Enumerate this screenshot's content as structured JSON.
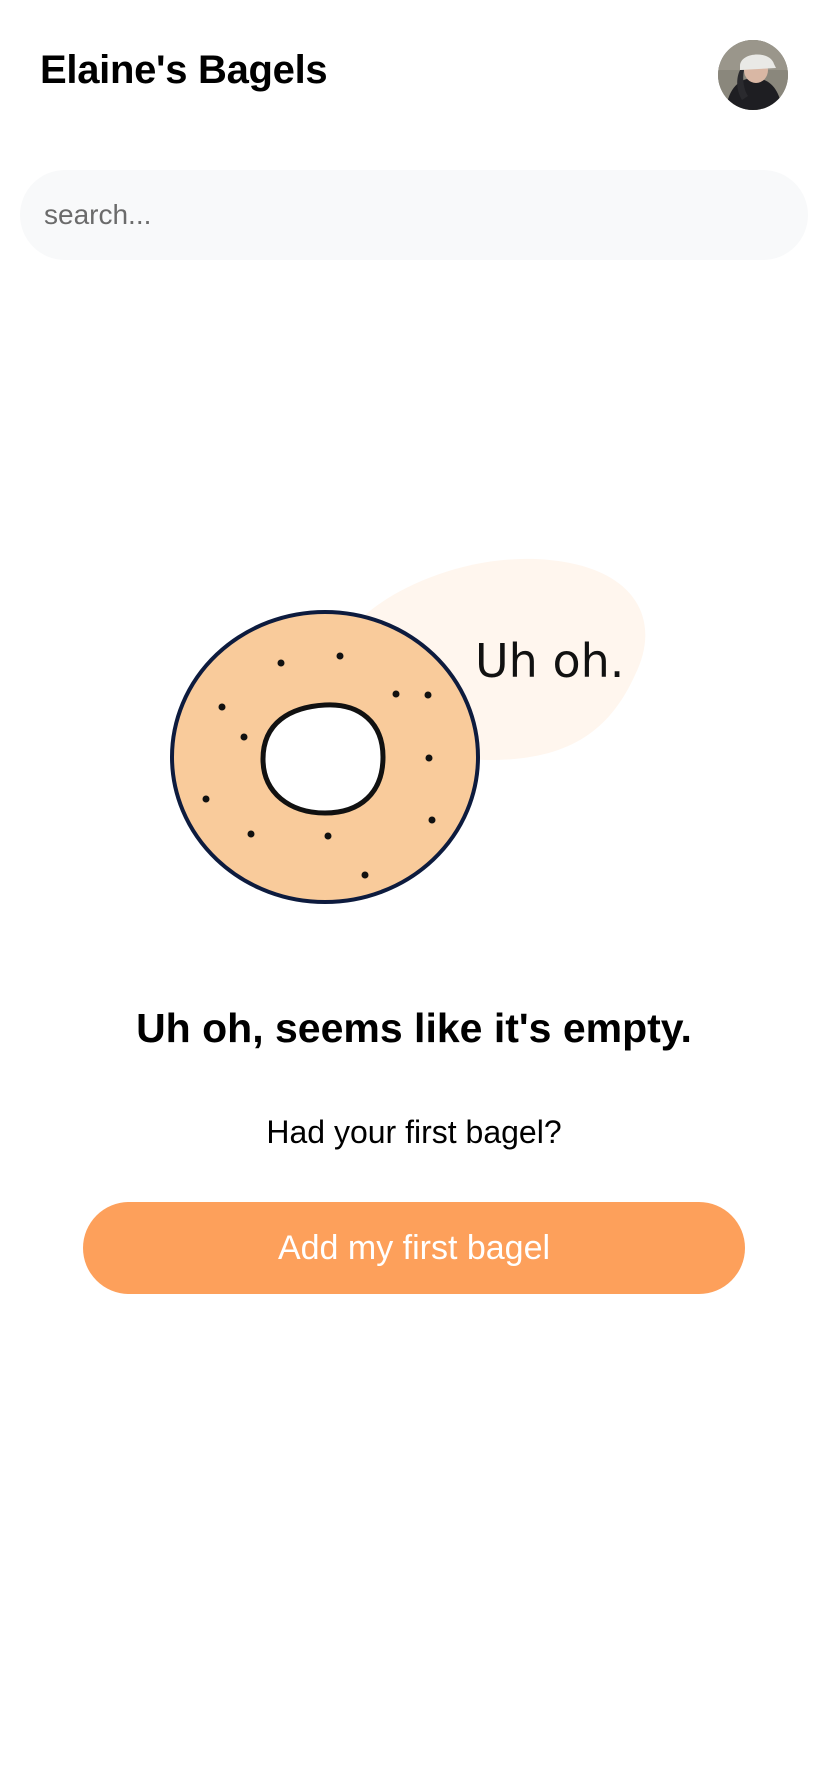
{
  "header": {
    "title": "Elaine's Bagels",
    "avatar_icon": "user-avatar-photo"
  },
  "search": {
    "placeholder": "search..."
  },
  "empty_state": {
    "illustration_icon": "bagel-illustration",
    "bubble_text": "Uh oh.",
    "title": "Uh oh, seems like it's empty.",
    "subtitle": "Had your first bagel?",
    "button_label": "Add my first bagel"
  },
  "colors": {
    "accent": "#fda05b",
    "bagel_fill": "#f9cb9b",
    "bagel_outline": "#0d1b3e",
    "bubble_fill": "#fff6ee",
    "search_bg": "#f8f9fa"
  }
}
